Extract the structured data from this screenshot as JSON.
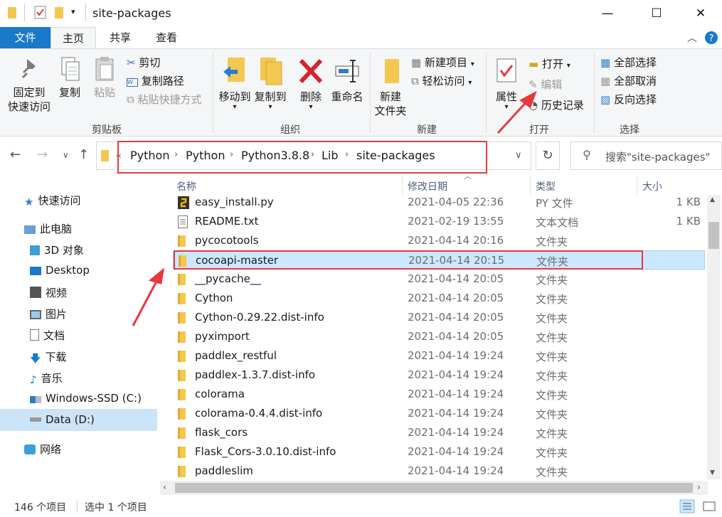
{
  "window": {
    "title": "site-packages"
  },
  "ribbon_tabs": [
    "文件",
    "主页",
    "共享",
    "查看"
  ],
  "ribbon": {
    "clipboard": {
      "pin": [
        "固定到",
        "快速访问"
      ],
      "copy": "复制",
      "paste": "粘贴",
      "cut": "剪切",
      "copy_path": "复制路径",
      "paste_shortcut": "粘贴快捷方式",
      "label": "剪贴板"
    },
    "organize": {
      "move_to": "移动到",
      "copy_to": "复制到",
      "delete": "删除",
      "rename": "重命名",
      "label": "组织"
    },
    "new": {
      "new_folder": [
        "新建",
        "文件夹"
      ],
      "new_item": "新建项目",
      "easy_access": "轻松访问",
      "label": "新建"
    },
    "open": {
      "properties": "属性",
      "open": "打开",
      "edit": "编辑",
      "history": "历史记录",
      "label": "打开"
    },
    "select": {
      "select_all": "全部选择",
      "select_none": "全部取消",
      "invert": "反向选择",
      "label": "选择"
    }
  },
  "address": {
    "overflow": "«",
    "crumbs": [
      "Python",
      "Python",
      "Python3.8.8",
      "Lib",
      "site-packages"
    ]
  },
  "search": {
    "placeholder": "搜索\"site-packages\""
  },
  "nav": {
    "quick_access": "快速访问",
    "this_pc": "此电脑",
    "objects3d": "3D 对象",
    "desktop": "Desktop",
    "videos": "视频",
    "pictures": "图片",
    "documents": "文档",
    "downloads": "下载",
    "music": "音乐",
    "drive_c": "Windows-SSD (C:)",
    "drive_d": "Data (D:)",
    "network": "网络"
  },
  "columns": {
    "name": "名称",
    "date": "修改日期",
    "type": "类型",
    "size": "大小"
  },
  "files": [
    {
      "name": "easy_install.py",
      "date": "2021-04-05 22:36",
      "type": "PY 文件",
      "size": "1 KB",
      "icon": "python-file-icon"
    },
    {
      "name": "README.txt",
      "date": "2021-02-19 13:55",
      "type": "文本文档",
      "size": "1 KB",
      "icon": "text-file-icon"
    },
    {
      "name": "pycocotools",
      "date": "2021-04-14 20:16",
      "type": "文件夹",
      "size": "",
      "icon": "folder-icon"
    },
    {
      "name": "cocoapi-master",
      "date": "2021-04-14 20:15",
      "type": "文件夹",
      "size": "",
      "icon": "folder-icon"
    },
    {
      "name": "__pycache__",
      "date": "2021-04-14 20:05",
      "type": "文件夹",
      "size": "",
      "icon": "folder-icon"
    },
    {
      "name": "Cython",
      "date": "2021-04-14 20:05",
      "type": "文件夹",
      "size": "",
      "icon": "folder-icon"
    },
    {
      "name": "Cython-0.29.22.dist-info",
      "date": "2021-04-14 20:05",
      "type": "文件夹",
      "size": "",
      "icon": "folder-icon"
    },
    {
      "name": "pyximport",
      "date": "2021-04-14 20:05",
      "type": "文件夹",
      "size": "",
      "icon": "folder-icon"
    },
    {
      "name": "paddlex_restful",
      "date": "2021-04-14 19:24",
      "type": "文件夹",
      "size": "",
      "icon": "folder-icon"
    },
    {
      "name": "paddlex-1.3.7.dist-info",
      "date": "2021-04-14 19:24",
      "type": "文件夹",
      "size": "",
      "icon": "folder-icon"
    },
    {
      "name": "colorama",
      "date": "2021-04-14 19:24",
      "type": "文件夹",
      "size": "",
      "icon": "folder-icon"
    },
    {
      "name": "colorama-0.4.4.dist-info",
      "date": "2021-04-14 19:24",
      "type": "文件夹",
      "size": "",
      "icon": "folder-icon"
    },
    {
      "name": "flask_cors",
      "date": "2021-04-14 19:24",
      "type": "文件夹",
      "size": "",
      "icon": "folder-icon"
    },
    {
      "name": "Flask_Cors-3.0.10.dist-info",
      "date": "2021-04-14 19:24",
      "type": "文件夹",
      "size": "",
      "icon": "folder-icon"
    },
    {
      "name": "paddleslim",
      "date": "2021-04-14 19:24",
      "type": "文件夹",
      "size": "",
      "icon": "folder-icon"
    }
  ],
  "selected_index": 3,
  "status": {
    "count": "146 个项目",
    "selected": "选中 1 个项目"
  },
  "colors": {
    "accent": "#1979ca",
    "annotation_red": "#e8383d",
    "selection": "#cce8ff",
    "folder": "#f4c750"
  }
}
